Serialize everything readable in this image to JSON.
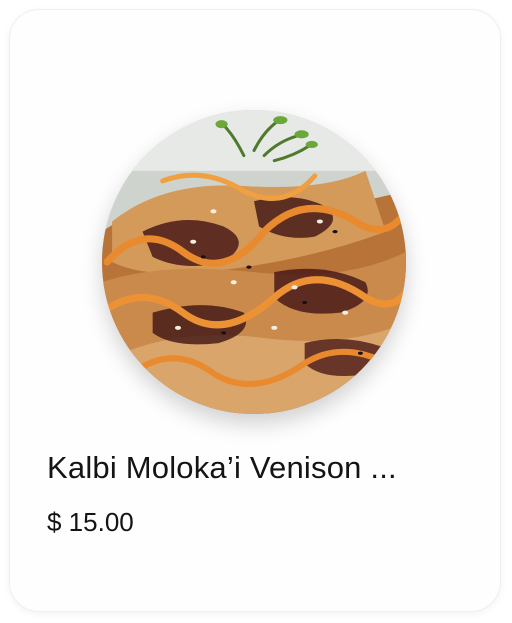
{
  "menu_item": {
    "name": "Kalbi Moloka’i Venison ...",
    "price": "$ 15.00",
    "image_icon": "food-photo"
  },
  "colors": {
    "card_background": "#fefefe",
    "card_border": "#efefef",
    "text": "#141414",
    "sauce_orange": "#e98a2e",
    "glaze_dark": "#4a1a18",
    "fried_golden": "#c9884a"
  }
}
